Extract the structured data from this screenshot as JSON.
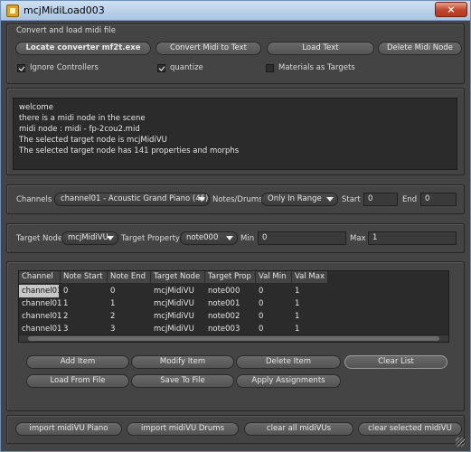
{
  "window": {
    "title": "mcjMidiLoad003",
    "close_label": "×"
  },
  "convert_group": {
    "label": "Convert and load midi file",
    "buttons": {
      "locate": "Locate converter mf2t.exe",
      "convert": "Convert Midi to Text",
      "load_text": "Load Text",
      "delete_node": "Delete Midi Node"
    },
    "checkboxes": {
      "ignore_controllers": {
        "label": "Ignore Controllers",
        "checked": true
      },
      "quantize": {
        "label": "quantize",
        "checked": true
      },
      "materials": {
        "label": "Materials as Targets",
        "checked": false
      }
    }
  },
  "log": {
    "lines": [
      "welcome",
      "there is a midi node in the scene",
      "midi node : midi - fp-2cou2.mid",
      "The selected target node is mcjMidiVU",
      "The selected target node has 141 properties and morphs"
    ]
  },
  "channels_row": {
    "channels_label": "Channels",
    "channel_value": "channel01 - Acoustic Grand Piano (45)",
    "notes_label": "Notes/Drums",
    "notes_value": "Only In Range",
    "start_label": "Start",
    "start_value": "0",
    "end_label": "End",
    "end_value": "0"
  },
  "target_row": {
    "node_label": "Target Node",
    "node_value": "mcjMidiVU",
    "prop_label": "Target Property",
    "prop_value": "note000",
    "min_label": "Min",
    "min_value": "0",
    "max_label": "Max",
    "max_value": "1"
  },
  "assignments": {
    "columns": [
      "Channel",
      "Note Start",
      "Note End",
      "Target Node",
      "Target Prop",
      "Val Min",
      "Val Max"
    ],
    "rows": [
      [
        "channel01",
        "0",
        "0",
        "mcjMidiVU",
        "note000",
        "0",
        "1"
      ],
      [
        "channel01",
        "1",
        "1",
        "mcjMidiVU",
        "note001",
        "0",
        "1"
      ],
      [
        "channel01",
        "2",
        "2",
        "mcjMidiVU",
        "note002",
        "0",
        "1"
      ],
      [
        "channel01",
        "3",
        "3",
        "mcjMidiVU",
        "note003",
        "0",
        "1"
      ]
    ],
    "buttons": {
      "add": "Add Item",
      "modify": "Modify Item",
      "delete": "Delete Item",
      "clear": "Clear List",
      "load": "Load From File",
      "save": "Save To File",
      "apply": "Apply Assignments"
    }
  },
  "bottom_buttons": {
    "import_piano": "import midiVU Piano",
    "import_drums": "import midiVU Drums",
    "clear_all": "clear all midiVUs",
    "clear_selected": "clear selected midiVU"
  }
}
